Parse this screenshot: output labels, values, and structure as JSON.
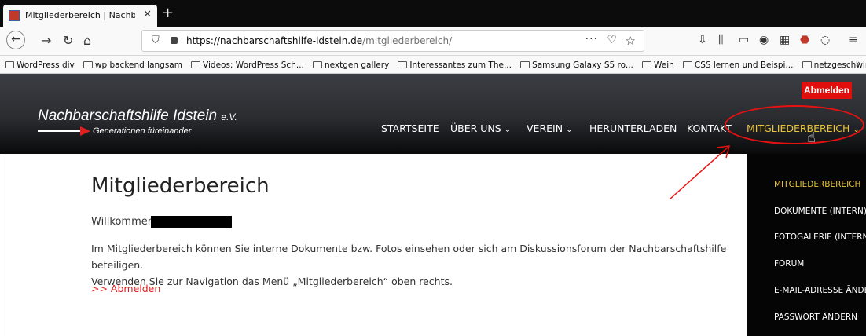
{
  "browser": {
    "tab_title": "Mitgliederbereich | Nachbarsch",
    "url_domain": "https://nachbarschaftshilfe-idstein.de",
    "url_path": "/mitgliederbereich/",
    "url_dots": "···",
    "bookmarks": [
      "WordPress div",
      "wp backend langsam",
      "Videos: WordPress Sch...",
      "nextgen gallery",
      "Interessantes zum The...",
      "Samsung Galaxy S5 ro...",
      "Wein",
      "CSS lernen und Beispi...",
      "netzgeschwindigkeit"
    ]
  },
  "site": {
    "logout_button": "Abmelden",
    "logo_title": "Nachbarschaftshilfe Idstein",
    "logo_suffix": "e.V.",
    "logo_subtitle": "Generationen füreinander",
    "menu": [
      {
        "label": "STARTSEITE",
        "has_dropdown": false
      },
      {
        "label": "ÜBER UNS",
        "has_dropdown": true
      },
      {
        "label": "VEREIN",
        "has_dropdown": true
      },
      {
        "label": "HERUNTERLADEN",
        "has_dropdown": false
      },
      {
        "label": "KONTAKT",
        "has_dropdown": false
      },
      {
        "label": "MITGLIEDERBEREICH",
        "has_dropdown": true,
        "active": true
      }
    ],
    "dropdown": [
      "MITGLIEDERBEREICH",
      "DOKUMENTE (INTERN)",
      "FOTOGALERIE (INTERN)",
      "FORUM",
      "E-MAIL-ADRESSE ÄNDERN",
      "PASSWORT ÄNDERN"
    ]
  },
  "content": {
    "title": "Mitgliederbereich",
    "welcome": "Willkommen,",
    "paragraph_1": "Im Mitgliederbereich können Sie interne Dokumente bzw. Fotos einsehen oder sich am Diskussionsforum der Nachbarschaftshilfe beteiligen.",
    "paragraph_2": "Verwenden Sie zur Navigation das Menü „Mitgliederbereich“ oben rechts.",
    "logout_link": ">> Abmelden"
  },
  "colors": {
    "accent_yellow": "#e8c436",
    "logout_red": "#e10e0e",
    "annotation_red": "#e81111"
  }
}
